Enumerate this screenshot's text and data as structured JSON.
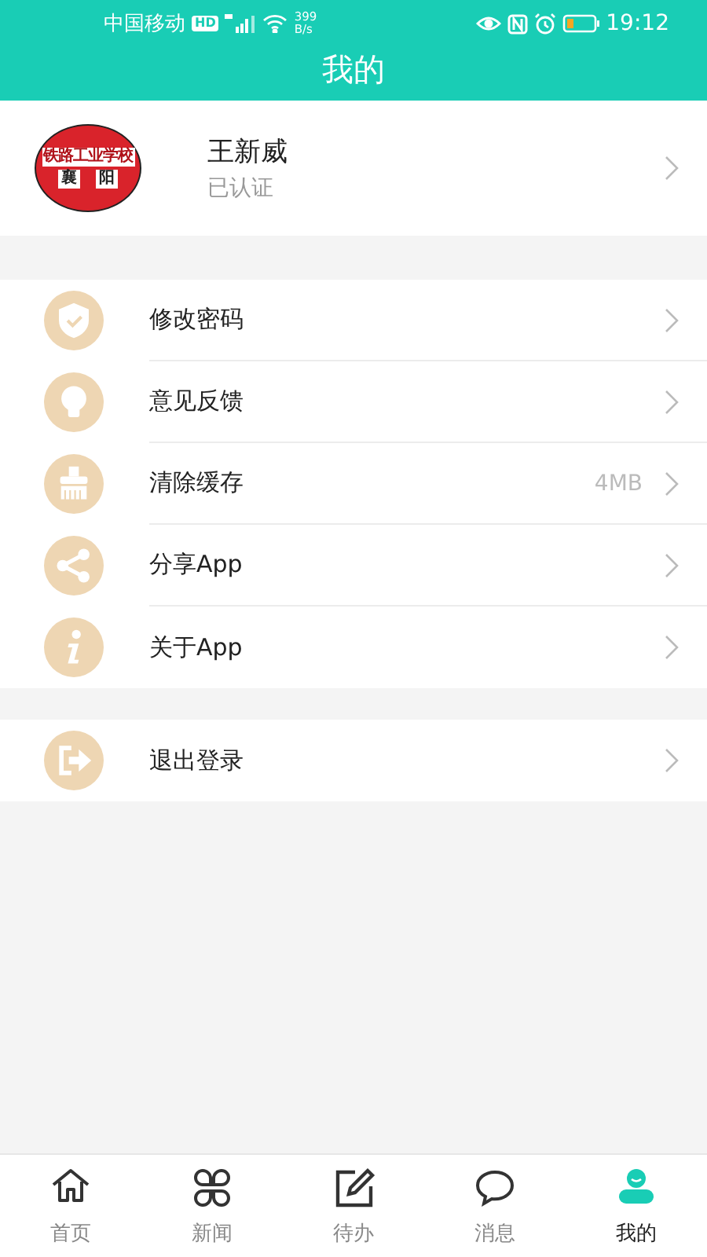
{
  "status_bar": {
    "carrier": "中国移动",
    "hd": "HD",
    "speed": "399",
    "speed_unit": "B/s",
    "time": "19:12"
  },
  "header": {
    "title": "我的"
  },
  "profile": {
    "name": "王新威",
    "status": "已认证",
    "logo": {
      "school": "铁路工业学校",
      "city_left": "襄",
      "city_right": "阳"
    }
  },
  "menu_groups": [
    {
      "items": [
        {
          "label": "修改密码"
        },
        {
          "label": "意见反馈"
        },
        {
          "label": "清除缓存",
          "value": "4MB"
        },
        {
          "label": "分享App"
        },
        {
          "label": "关于App"
        }
      ]
    },
    {
      "items": [
        {
          "label": "退出登录"
        }
      ]
    }
  ],
  "tab_bar": {
    "tabs": [
      {
        "label": "首页",
        "selected": false
      },
      {
        "label": "新闻",
        "selected": false
      },
      {
        "label": "待办",
        "selected": false
      },
      {
        "label": "消息",
        "selected": false
      },
      {
        "label": "我的",
        "selected": true
      }
    ]
  }
}
